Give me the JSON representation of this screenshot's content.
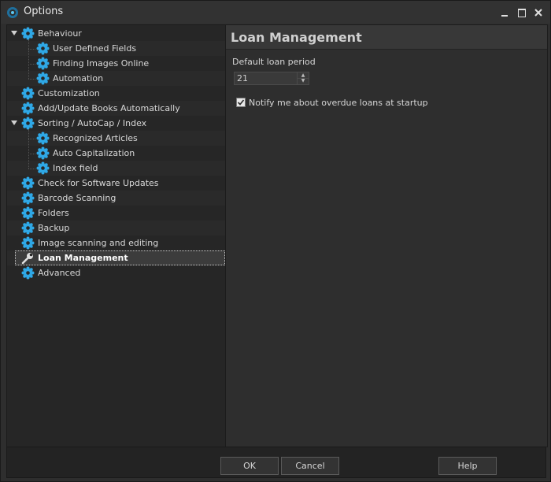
{
  "window": {
    "title": "Options"
  },
  "tree": {
    "items": [
      {
        "label": "Behaviour",
        "level": 0,
        "expanded": true,
        "icon": "gear-icon"
      },
      {
        "label": "User Defined Fields",
        "level": 1,
        "icon": "gear-icon"
      },
      {
        "label": "Finding Images Online",
        "level": 1,
        "icon": "gear-icon"
      },
      {
        "label": "Automation",
        "level": 1,
        "icon": "gear-icon"
      },
      {
        "label": "Customization",
        "level": 0,
        "icon": "gear-icon"
      },
      {
        "label": "Add/Update Books Automatically",
        "level": 0,
        "icon": "gear-icon"
      },
      {
        "label": "Sorting / AutoCap / Index",
        "level": 0,
        "expanded": true,
        "icon": "gear-icon"
      },
      {
        "label": "Recognized Articles",
        "level": 1,
        "icon": "gear-icon"
      },
      {
        "label": "Auto Capitalization",
        "level": 1,
        "icon": "gear-icon"
      },
      {
        "label": "Index field",
        "level": 1,
        "icon": "gear-icon"
      },
      {
        "label": "Check for Software Updates",
        "level": 0,
        "icon": "gear-icon"
      },
      {
        "label": "Barcode Scanning",
        "level": 0,
        "icon": "gear-icon"
      },
      {
        "label": "Folders",
        "level": 0,
        "icon": "gear-icon"
      },
      {
        "label": "Backup",
        "level": 0,
        "icon": "gear-icon"
      },
      {
        "label": "Image scanning and editing",
        "level": 0,
        "icon": "gear-icon"
      },
      {
        "label": "Loan Management",
        "level": 0,
        "selected": true,
        "icon": "wrench-icon"
      },
      {
        "label": "Advanced",
        "level": 0,
        "icon": "gear-icon"
      }
    ]
  },
  "content": {
    "title": "Loan Management",
    "loan_period_label": "Default loan period",
    "loan_period_value": "21",
    "notify_label": "Notify me about overdue loans at startup",
    "notify_checked": true
  },
  "buttons": {
    "ok": "OK",
    "cancel": "Cancel",
    "help": "Help"
  },
  "colors": {
    "accent": "#2fa8e6",
    "background": "#2e2e2e",
    "panel": "#262626"
  }
}
